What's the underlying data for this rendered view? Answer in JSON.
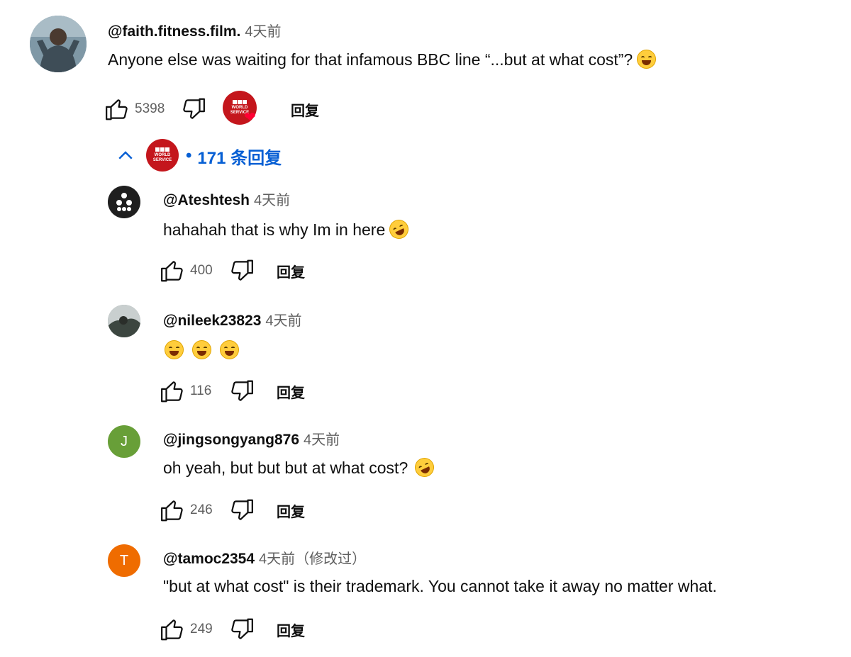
{
  "main_comment": {
    "handle": "@faith.fitness.film.",
    "time": "4天前",
    "text": "Anyone else was waiting for that infamous BBC line “...but at what cost”?",
    "emoji": "grinning-squinting-face",
    "likes": "5398",
    "reply_label": "回复",
    "hearted_by": "BBC World Service",
    "avatar_icon": "user-photo-avatar"
  },
  "replies_toggle": {
    "bullet": "•",
    "label": "171 条回复"
  },
  "replies": [
    {
      "handle": "@Ateshtesh",
      "time": "4天前",
      "text": "hahahah that is why Im in here",
      "emoji": "rolling-on-floor-laughing",
      "likes": "400",
      "reply_label": "回复",
      "avatar_icon": "dots-avatar",
      "avatar_color": "#1f1f1f"
    },
    {
      "handle": "@nileek23823",
      "time": "4天前",
      "text": "",
      "emoji": "grinning-squinting-face x3",
      "likes": "116",
      "reply_label": "回复",
      "avatar_icon": "photo-avatar",
      "avatar_color": "#7b8a8c"
    },
    {
      "handle": "@jingsongyang876",
      "time": "4天前",
      "text": "oh yeah, but but but at what cost?",
      "emoji": "rolling-on-floor-laughing",
      "likes": "246",
      "reply_label": "回复",
      "avatar_letter": "J",
      "avatar_color": "#689f38"
    },
    {
      "handle": "@tamoc2354",
      "time": "4天前（修改过）",
      "text": "\"but at what cost\" is their trademark. You cannot take it away no matter what.",
      "emoji": "",
      "likes": "249",
      "reply_label": "回复",
      "avatar_letter": "T",
      "avatar_color": "#ef6c00"
    }
  ],
  "colors": {
    "link_blue": "#065fd4",
    "bbc_red": "#c4161c",
    "heart_red": "#ff0033",
    "text_primary": "#0f0f0f",
    "text_secondary": "#606060"
  }
}
